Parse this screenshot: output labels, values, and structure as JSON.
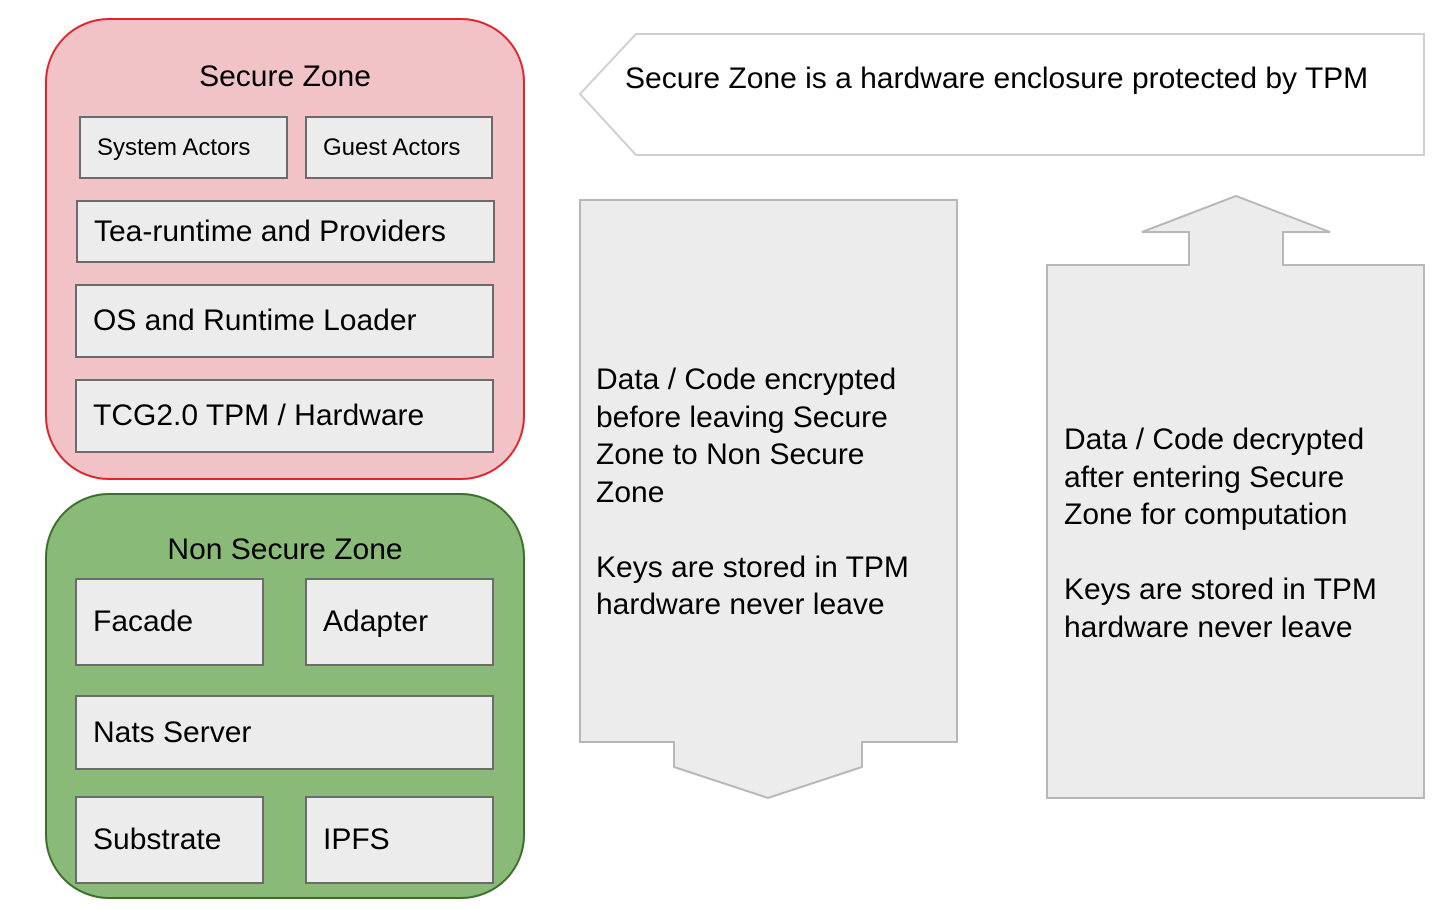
{
  "secure_zone": {
    "title": "Secure Zone",
    "border_color": "#e3222a",
    "fill_color": "#f2c3c6",
    "boxes": [
      "System Actors",
      "Guest  Actors",
      "Tea-runtime and Providers",
      "OS and Runtime Loader",
      "TCG2.0 TPM / Hardware"
    ]
  },
  "non_secure_zone": {
    "title": "Non Secure Zone",
    "border_color": "#3a6e2a",
    "fill_color": "#8aba78",
    "boxes": [
      "Facade",
      "Adapter",
      "Nats Server",
      "Substrate",
      "IPFS"
    ]
  },
  "callout": {
    "text": "Secure Zone is a hardware enclosure protected by TPM"
  },
  "down_arrow": {
    "text": "Data / Code encrypted\nbefore leaving Secure\nZone to Non Secure\nZone\n\nKeys are stored in TPM\nhardware never leave"
  },
  "up_arrow": {
    "text": "Data / Code decrypted\nafter entering Secure\nZone for computation\n\nKeys are stored in TPM\nhardware never leave"
  }
}
